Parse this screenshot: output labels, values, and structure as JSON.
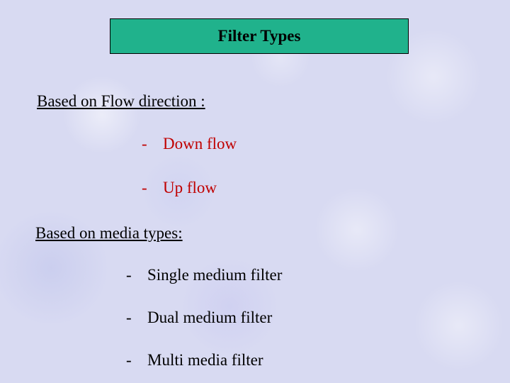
{
  "title": "Filter Types",
  "sections": [
    {
      "heading": "Based on Flow direction :",
      "items": [
        "Down flow",
        "Up flow"
      ],
      "item_color": "red"
    },
    {
      "heading": "Based on media types:",
      "items": [
        "Single medium filter",
        "Dual medium filter",
        "Multi media filter"
      ],
      "item_color": "black"
    }
  ]
}
